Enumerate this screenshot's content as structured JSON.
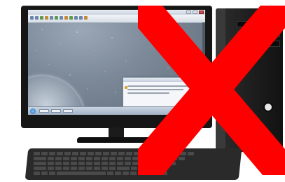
{
  "scene": {
    "description_icons": [
      "desktop-monitor",
      "pc-tower",
      "keyboard",
      "red-x-mark"
    ],
    "colors": {
      "cross": "#ff0000",
      "device": "#1a1a1a"
    }
  },
  "screen": {
    "window_title": "",
    "dialog_title": ""
  }
}
